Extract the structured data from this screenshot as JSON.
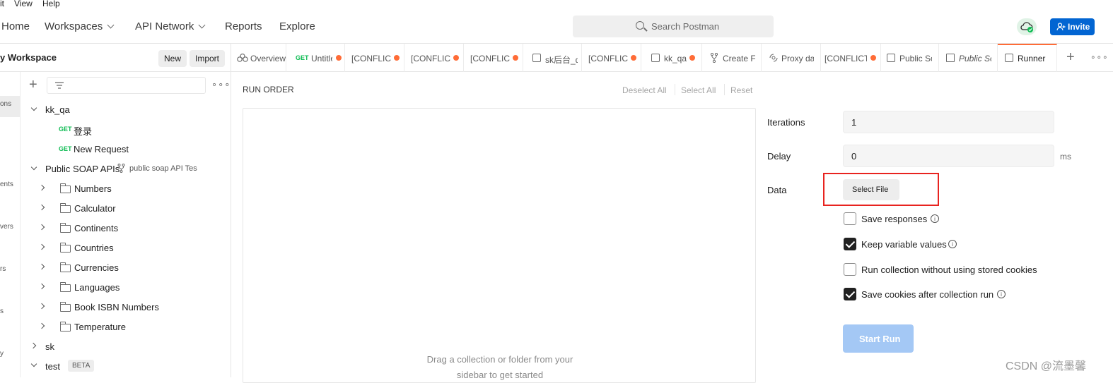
{
  "menubar": {
    "edit": "it",
    "view": "View",
    "help": "Help"
  },
  "topnav": {
    "home": "Home",
    "workspaces": "Workspaces",
    "api_network": "API Network",
    "reports": "Reports",
    "explore": "Explore",
    "search_placeholder": "Search Postman",
    "invite": "Invite"
  },
  "sidebar": {
    "workspace_title": "y Workspace",
    "new_label": "New",
    "import_label": "Import",
    "rail": [
      "ons",
      "ents",
      "vers",
      "rs",
      "s",
      "y"
    ],
    "tree": {
      "kk_qa": "kk_qa",
      "req1_method": "GET",
      "req1_name": "登录",
      "req2_method": "GET",
      "req2_name": "New Request",
      "public_soap": "Public SOAP APIs",
      "public_soap_fork": "public soap API Tes",
      "folders": [
        "Numbers",
        "Calculator",
        "Continents",
        "Countries",
        "Currencies",
        "Languages",
        "Book ISBN Numbers",
        "Temperature"
      ],
      "sk": "sk",
      "test": "test",
      "beta": "BETA"
    }
  },
  "tabs": [
    {
      "label": "Overview"
    },
    {
      "method": "GET",
      "label": "Untitle"
    },
    {
      "label": "[CONFLICT"
    },
    {
      "label": "[CONFLICT"
    },
    {
      "label": "[CONFLICT"
    },
    {
      "label": "sk后台_q"
    },
    {
      "label": "[CONFLICT"
    },
    {
      "label": "kk_qa"
    },
    {
      "label": "Create F"
    },
    {
      "label": "Proxy da"
    },
    {
      "label": "[CONFLICT"
    },
    {
      "label": "Public So"
    },
    {
      "label": "Public So"
    },
    {
      "label": "Runner"
    }
  ],
  "runner": {
    "run_order": "RUN ORDER",
    "deselect_all": "Deselect All",
    "select_all": "Select All",
    "reset": "Reset",
    "drop_hint_1": "Drag a collection or folder from your",
    "drop_hint_2": "sidebar to get started",
    "iterations_label": "Iterations",
    "iterations_value": "1",
    "delay_label": "Delay",
    "delay_value": "0",
    "delay_unit": "ms",
    "data_label": "Data",
    "select_file": "Select File",
    "opt_save_responses": "Save responses",
    "opt_keep_variables": "Keep variable values",
    "opt_no_cookies": "Run collection without using stored cookies",
    "opt_save_cookies": "Save cookies after collection run",
    "start_run": "Start Run"
  },
  "watermark": "CSDN @流墨馨",
  "colors": {
    "accent": "#ff6c37",
    "primary": "#0265d2",
    "start_run_disabled": "#a4c8f5",
    "get": "#0cbb52",
    "highlight_box": "#e8231f"
  }
}
